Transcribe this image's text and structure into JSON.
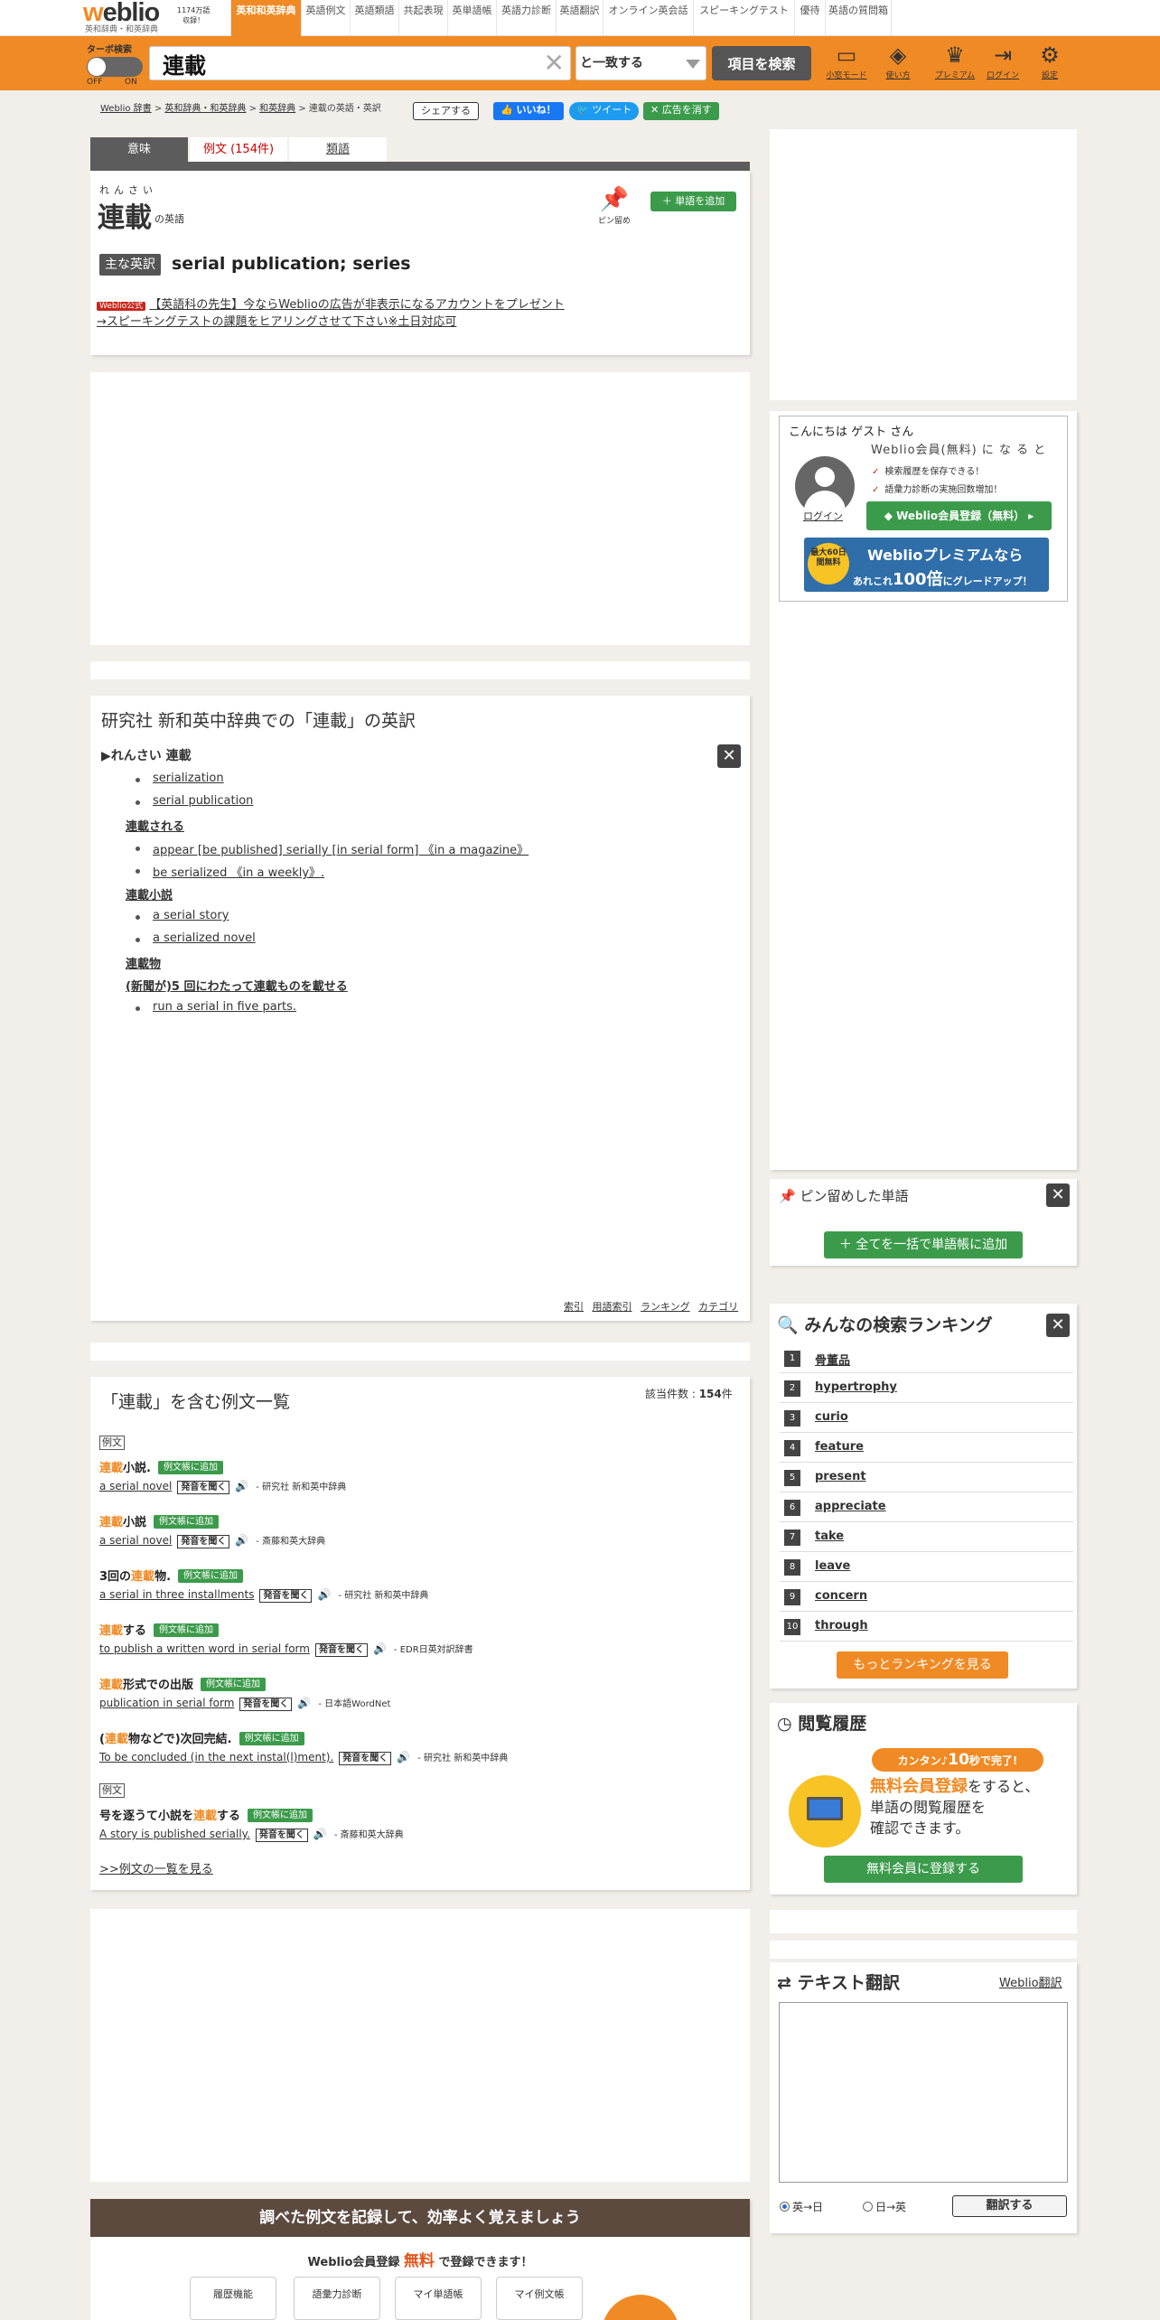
{
  "header": {
    "logo_text_a": "w",
    "logo_text_b": "eblio",
    "logo_sub": "英和辞典・和英辞典",
    "badge_line1": "1174万語",
    "badge_line2": "収録！",
    "tabs": [
      {
        "label": "英和和英辞典",
        "active": true
      },
      {
        "label": "英語例文"
      },
      {
        "label": "英語類語"
      },
      {
        "label": "共起表現"
      },
      {
        "label": "英単語帳"
      },
      {
        "label": "英語力診断"
      },
      {
        "label": "英語翻訳"
      },
      {
        "label": "オンライン英会話"
      },
      {
        "label": "スピーキングテスト"
      },
      {
        "label": "優待"
      },
      {
        "label": "英語の質問箱"
      }
    ]
  },
  "search": {
    "turbo_label": "ターボ検索",
    "off": "OFF",
    "on": "ON",
    "query": "連載",
    "match_mode": "と一致する",
    "submit_label": "項目を検索",
    "icons": [
      {
        "icon": "monitor-icon",
        "label": "小窓モード"
      },
      {
        "icon": "beginner-mark-icon",
        "label": "使い方"
      },
      {
        "icon": "premium-icon",
        "label": "プレミアム"
      },
      {
        "icon": "login-icon",
        "label": "ログイン"
      },
      {
        "icon": "gear-icon",
        "label": "設定"
      }
    ]
  },
  "breadcrumb": {
    "items": [
      "Weblio 辞書",
      "英和辞典・和英辞典",
      "和英辞典",
      "連載の英語・英訳"
    ],
    "share": "シェアする",
    "like": "いいね！",
    "tweet": "ツイート",
    "hide_ads": "広告を消す"
  },
  "entry": {
    "tabs": [
      "意味",
      "例文 (154件)",
      "類語"
    ],
    "ruby": "れんさい",
    "headword": "連載",
    "suffix": "の英語",
    "pin_label": "ピン留め",
    "add_word": "単語を追加",
    "main_label": "主な英訳",
    "main_translation": "serial publication; series",
    "promo_badge": "Weblio公式",
    "promo_line1": "【英語科の先生】今ならWeblioの広告が非表示になるアカウントをプレゼント",
    "promo_line2": "→スピーキングテストの課題をヒアリングさせて下さい※土日対応可"
  },
  "dictionary": {
    "title": "研究社 新和英中辞典での「連載」の英訳",
    "heading": "▶れんさい 連載",
    "lines": [
      {
        "type": "item",
        "text": "serialization"
      },
      {
        "type": "item",
        "text": "serial publication"
      },
      {
        "type": "sub",
        "text": "連載される"
      },
      {
        "type": "item",
        "text": "appear [be published] serially [in serial form] 《in a magazine》"
      },
      {
        "type": "item",
        "text": "be serialized 《in a weekly》."
      },
      {
        "type": "sub",
        "text": "連載小説"
      },
      {
        "type": "item",
        "text": "a serial story"
      },
      {
        "type": "item",
        "text": "a serialized novel"
      },
      {
        "type": "sub",
        "text": "連載物"
      },
      {
        "type": "sub",
        "text": "(新聞が)5 回にわたって連載ものを載せる"
      },
      {
        "type": "item",
        "text": "run a serial in five parts."
      }
    ],
    "footer": [
      "索引",
      "用語索引",
      "ランキング",
      "カテゴリ"
    ]
  },
  "examples": {
    "title": "「連載」を含む例文一覧",
    "count_label": "該当件数 : ",
    "count": "154",
    "count_unit": "件",
    "tag": "例文",
    "add_label": "例文帳に追加",
    "sound_label": "発音を聞く",
    "items": [
      {
        "pre": "",
        "hl": "連載",
        "post": "小説.",
        "en": "a serial novel",
        "src": "- 研究社 新和英中辞典",
        "tag": true
      },
      {
        "pre": "",
        "hl": "連載",
        "post": "小説",
        "en": "a serial novel",
        "src": "- 斎藤和英大辞典"
      },
      {
        "pre": "3回の",
        "hl": "連載",
        "post": "物.",
        "en": "a serial in three installments",
        "src": "- 研究社 新和英中辞典"
      },
      {
        "pre": "",
        "hl": "連載",
        "post": "する",
        "en": "to publish a written word in serial form",
        "src": "- EDR日英対訳辞書"
      },
      {
        "pre": "",
        "hl": "連載",
        "post": "形式での出版",
        "en": "publication in serial form",
        "src": "- 日本語WordNet"
      },
      {
        "pre": "(",
        "hl": "連載",
        "post": "物などで)次回完結.",
        "en": "To be concluded (in the next instal(l)ment).",
        "src": "- 研究社 新和英中辞典"
      },
      {
        "pre": "号を逐うて小説を",
        "hl": "連載",
        "post": "する",
        "en": "A story is published serially.",
        "src": "- 斎藤和英大辞典",
        "tag": true
      }
    ],
    "more": ">>例文の一覧を見る"
  },
  "memo": {
    "heading": "調べた例文を記録して、効率よく覚えましょう",
    "sub_a": "Weblio会員登録 ",
    "sub_free": "無料",
    "sub_b": " で登録できます！",
    "cards": [
      "履歴機能",
      "語彙力診断",
      "マイ単語帳",
      "マイ例文帳"
    ]
  },
  "sidebar": {
    "hello": "こんにちは ゲスト さん",
    "member": "Weblio会員(無料) に な る と",
    "benefits": [
      "検索履歴を保存できる！",
      "語彙力診断の実施回数増加！"
    ],
    "login": "ログイン",
    "register": "Weblio会員登録（無料）",
    "premium_a": "Weblioプレミアムなら",
    "premium_b1": "あれこれ",
    "premium_b2": "100倍",
    "premium_b3": "にグレードアップ！",
    "premium_circle": "最大60日間無料",
    "pinned_title": "ピン留めした単語",
    "pinned_add": "全てを一括で単語帳に追加",
    "ranking_title": "みんなの検索ランキング",
    "ranking": [
      "骨董品",
      "hypertrophy",
      "curio",
      "feature",
      "present",
      "appreciate",
      "take",
      "leave",
      "concern",
      "through"
    ],
    "ranking_more": "もっとランキングを見る",
    "history_title": "閲覧履歴",
    "history_pill_a": "カンタン♪",
    "history_pill_b": "10",
    "history_pill_c": "秒で完了!",
    "history_em": "無料会員登録",
    "history_text_a": "をすると、",
    "history_text_b": "単語の閲覧履歴を",
    "history_text_c": "確認できます。",
    "history_btn": "無料会員に登録する",
    "translate_title": "テキスト翻訳",
    "translate_link": "Weblio翻訳",
    "radio_en_ja": "英→日",
    "radio_ja_en": "日→英",
    "translate_btn": "翻訳する"
  },
  "colors": {
    "accent": "#f08a24",
    "green": "#3c9b4b",
    "dark": "#5c5c5c"
  }
}
